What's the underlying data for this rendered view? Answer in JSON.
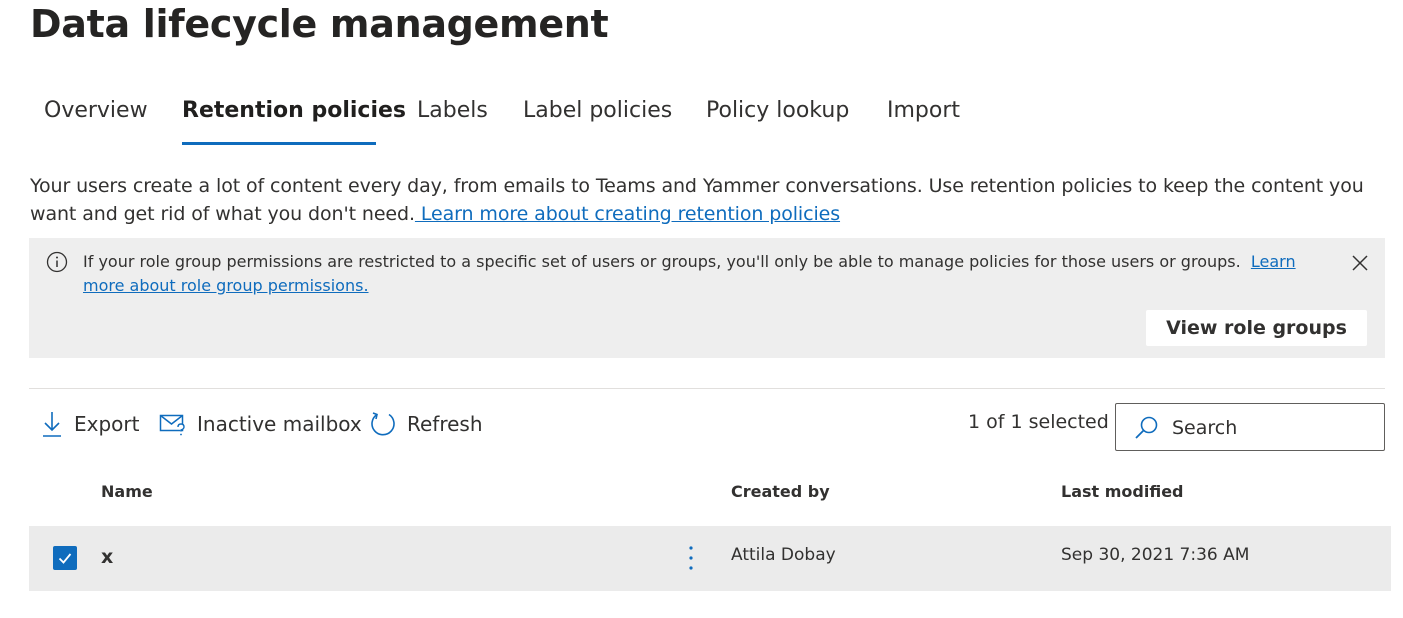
{
  "page": {
    "title": "Data lifecycle management"
  },
  "tabs": [
    {
      "label": "Overview",
      "active": false
    },
    {
      "label": "Retention policies",
      "active": true
    },
    {
      "label": "Labels",
      "active": false
    },
    {
      "label": "Label policies",
      "active": false
    },
    {
      "label": "Policy lookup",
      "active": false
    },
    {
      "label": "Import",
      "active": false
    }
  ],
  "description": {
    "text": "Your users create a lot of content every day, from emails to Teams and Yammer conversations. Use retention policies to keep the content you want and get rid of what you don't need.",
    "link_text": " Learn more about creating retention policies"
  },
  "banner": {
    "icon": "info-icon",
    "message": "If your role group permissions are restricted to a specific set of users or groups, you'll only be able to manage policies for those users or groups.",
    "link_text": "Learn more about role group permissions.",
    "button_label": "View role groups",
    "close_icon": "close-icon"
  },
  "command_bar": {
    "export_label": "Export",
    "export_icon": "download-icon",
    "inactive_mailbox_label": "Inactive mailbox",
    "inactive_mailbox_icon": "mail-question-icon",
    "refresh_label": "Refresh",
    "refresh_icon": "refresh-icon",
    "selected_count": "1 of 1 selected",
    "search_placeholder": "Search",
    "search_icon": "search-icon"
  },
  "table": {
    "columns": [
      "Name",
      "Created by",
      "Last modified"
    ],
    "rows": [
      {
        "name": "x",
        "created_by": "Attila Dobay",
        "last_modified": "Sep 30, 2021 7:36 AM",
        "selected": true
      }
    ]
  },
  "colors": {
    "accent": "#0f6cbd",
    "banner_bg": "#eeeeee",
    "row_selected_bg": "#ebebeb",
    "text": "#323130"
  }
}
